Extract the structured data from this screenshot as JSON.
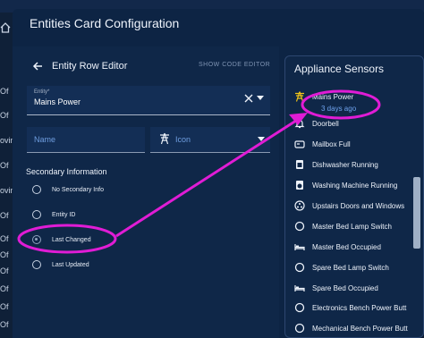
{
  "sidebar": {
    "fragments": [
      "Of",
      "Of",
      "ovin",
      "Of",
      "ovin",
      "Of",
      "Of",
      "Of",
      "Of",
      "Of",
      "Of",
      "Of"
    ]
  },
  "dialog": {
    "title": "Entities Card Configuration"
  },
  "editor": {
    "header": "Entity Row Editor",
    "show_code": "SHOW CODE EDITOR",
    "entity_label": "Entity*",
    "entity_value": "Mains Power",
    "name_label": "Name",
    "icon_label": "Icon",
    "secondary_title": "Secondary Information",
    "options": [
      {
        "label": "No Secondary Info",
        "selected": false
      },
      {
        "label": "Entity ID",
        "selected": false
      },
      {
        "label": "Last Changed",
        "selected": true
      },
      {
        "label": "Last Updated",
        "selected": false
      }
    ]
  },
  "card": {
    "title": "Appliance Sensors",
    "first_sub": "3 days ago",
    "rows": [
      {
        "name": "Mains Power",
        "icon": "transmission-tower-icon"
      },
      {
        "name": "Doorbell",
        "icon": "bell-icon"
      },
      {
        "name": "Mailbox Full",
        "icon": "mailbox-icon"
      },
      {
        "name": "Dishwasher Running",
        "icon": "dishwasher-icon"
      },
      {
        "name": "Washing Machine Running",
        "icon": "washing-machine-icon"
      },
      {
        "name": "Upstairs Doors and Windows",
        "icon": "dots-circle-icon"
      },
      {
        "name": "Master Bed Lamp Switch",
        "icon": "circle-icon"
      },
      {
        "name": "Master Bed Occupied",
        "icon": "bed-icon"
      },
      {
        "name": "Spare Bed Lamp Switch",
        "icon": "circle-icon"
      },
      {
        "name": "Spare Bed Occupied",
        "icon": "bed-icon"
      },
      {
        "name": "Electronics Bench Power Butt",
        "icon": "circle-icon"
      },
      {
        "name": "Mechanical Bench Power Butt",
        "icon": "circle-icon"
      }
    ]
  },
  "colors": {
    "annotation": "#e01cd5",
    "secondary_text": "#6fa3ee"
  }
}
